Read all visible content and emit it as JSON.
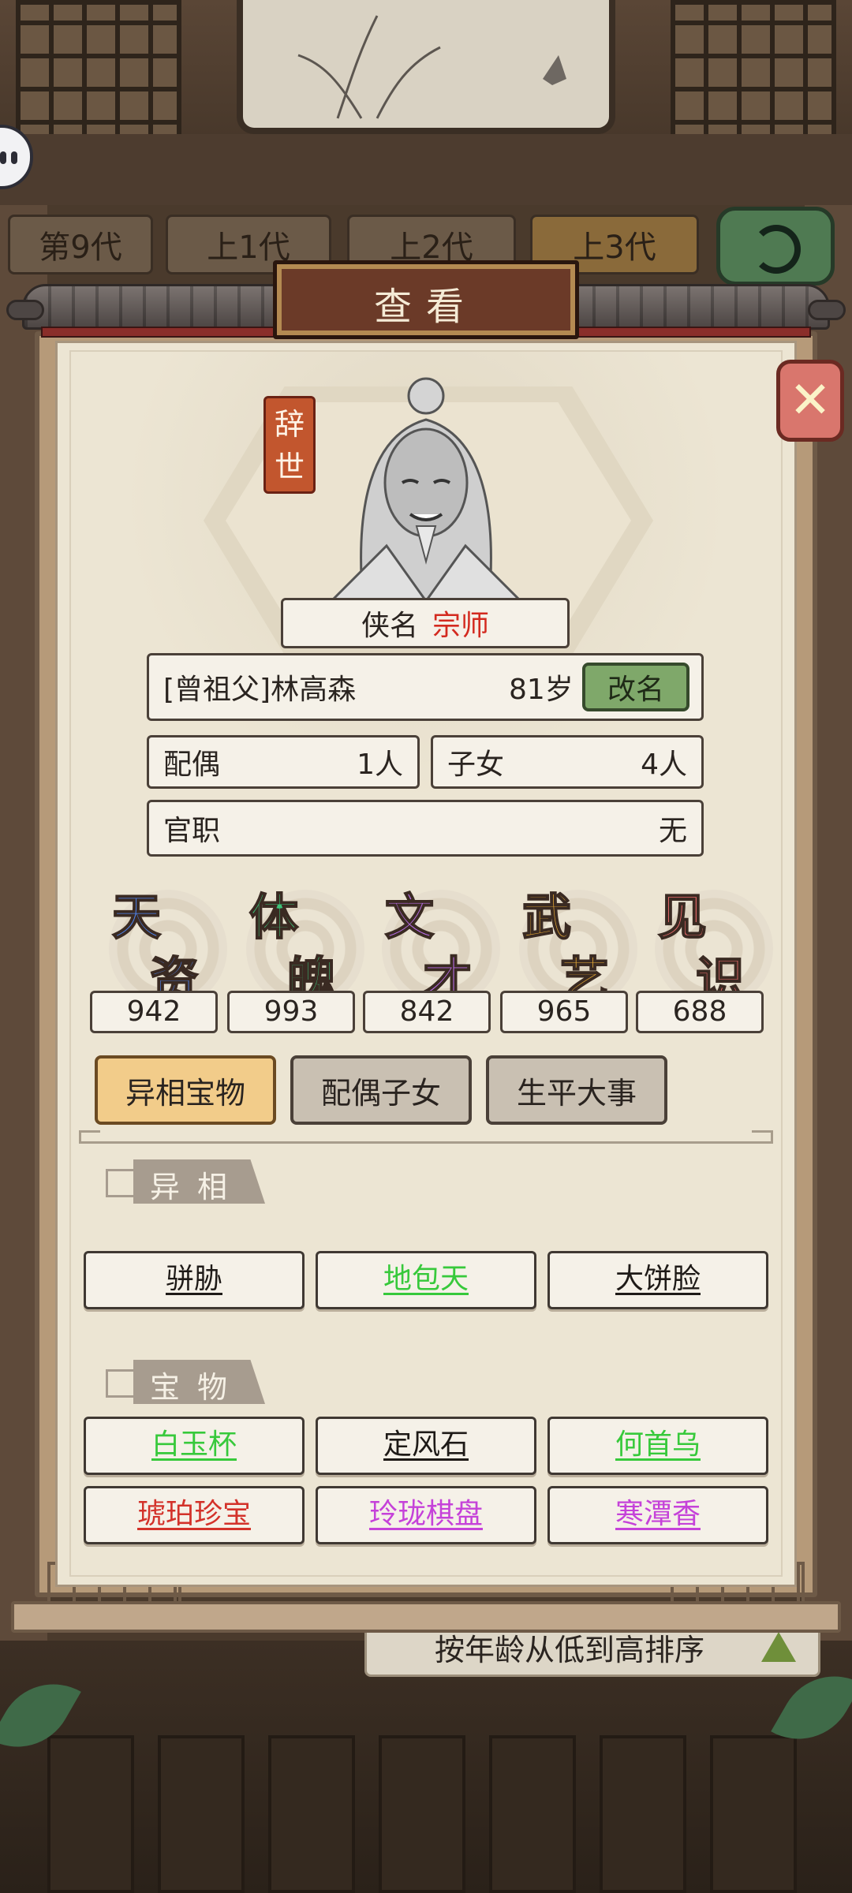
{
  "generation_tabs": [
    "第9代",
    "上1代",
    "上2代",
    "上3代"
  ],
  "sort_label": "按年龄从低到高排序",
  "modal": {
    "title": "查看",
    "status_seal": "辞世",
    "nickname_label": "侠名",
    "nickname_value": "宗师",
    "relation_name": "[曾祖父]林高森",
    "age": "81岁",
    "rename_label": "改名",
    "spouse_label": "配偶",
    "spouse_count": "1人",
    "children_label": "子女",
    "children_count": "4人",
    "office_label": "官职",
    "office_value": "无"
  },
  "stats": [
    {
      "c1": "天",
      "c2": "资",
      "value": "942",
      "color": "#4d84f0"
    },
    {
      "c1": "体",
      "c2": "魄",
      "value": "993",
      "color": "#3cc47a"
    },
    {
      "c1": "文",
      "c2": "才",
      "value": "842",
      "color": "#b96ee8"
    },
    {
      "c1": "武",
      "c2": "艺",
      "value": "965",
      "color": "#f0b036"
    },
    {
      "c1": "见",
      "c2": "识",
      "value": "688",
      "color": "#f06e6e"
    }
  ],
  "tabs": [
    "异相宝物",
    "配偶子女",
    "生平大事"
  ],
  "traits_header": "异相",
  "traits": [
    {
      "label": "骈胁",
      "color": "black"
    },
    {
      "label": "地包天",
      "color": "green"
    },
    {
      "label": "大饼脸",
      "color": "black"
    }
  ],
  "treasures_header": "宝物",
  "treasures": [
    {
      "label": "白玉杯",
      "color": "green"
    },
    {
      "label": "定风石",
      "color": "black"
    },
    {
      "label": "何首乌",
      "color": "green"
    },
    {
      "label": "琥珀珍宝",
      "color": "red"
    },
    {
      "label": "玲珑棋盘",
      "color": "purple"
    },
    {
      "label": "寒潭香",
      "color": "purple"
    }
  ]
}
